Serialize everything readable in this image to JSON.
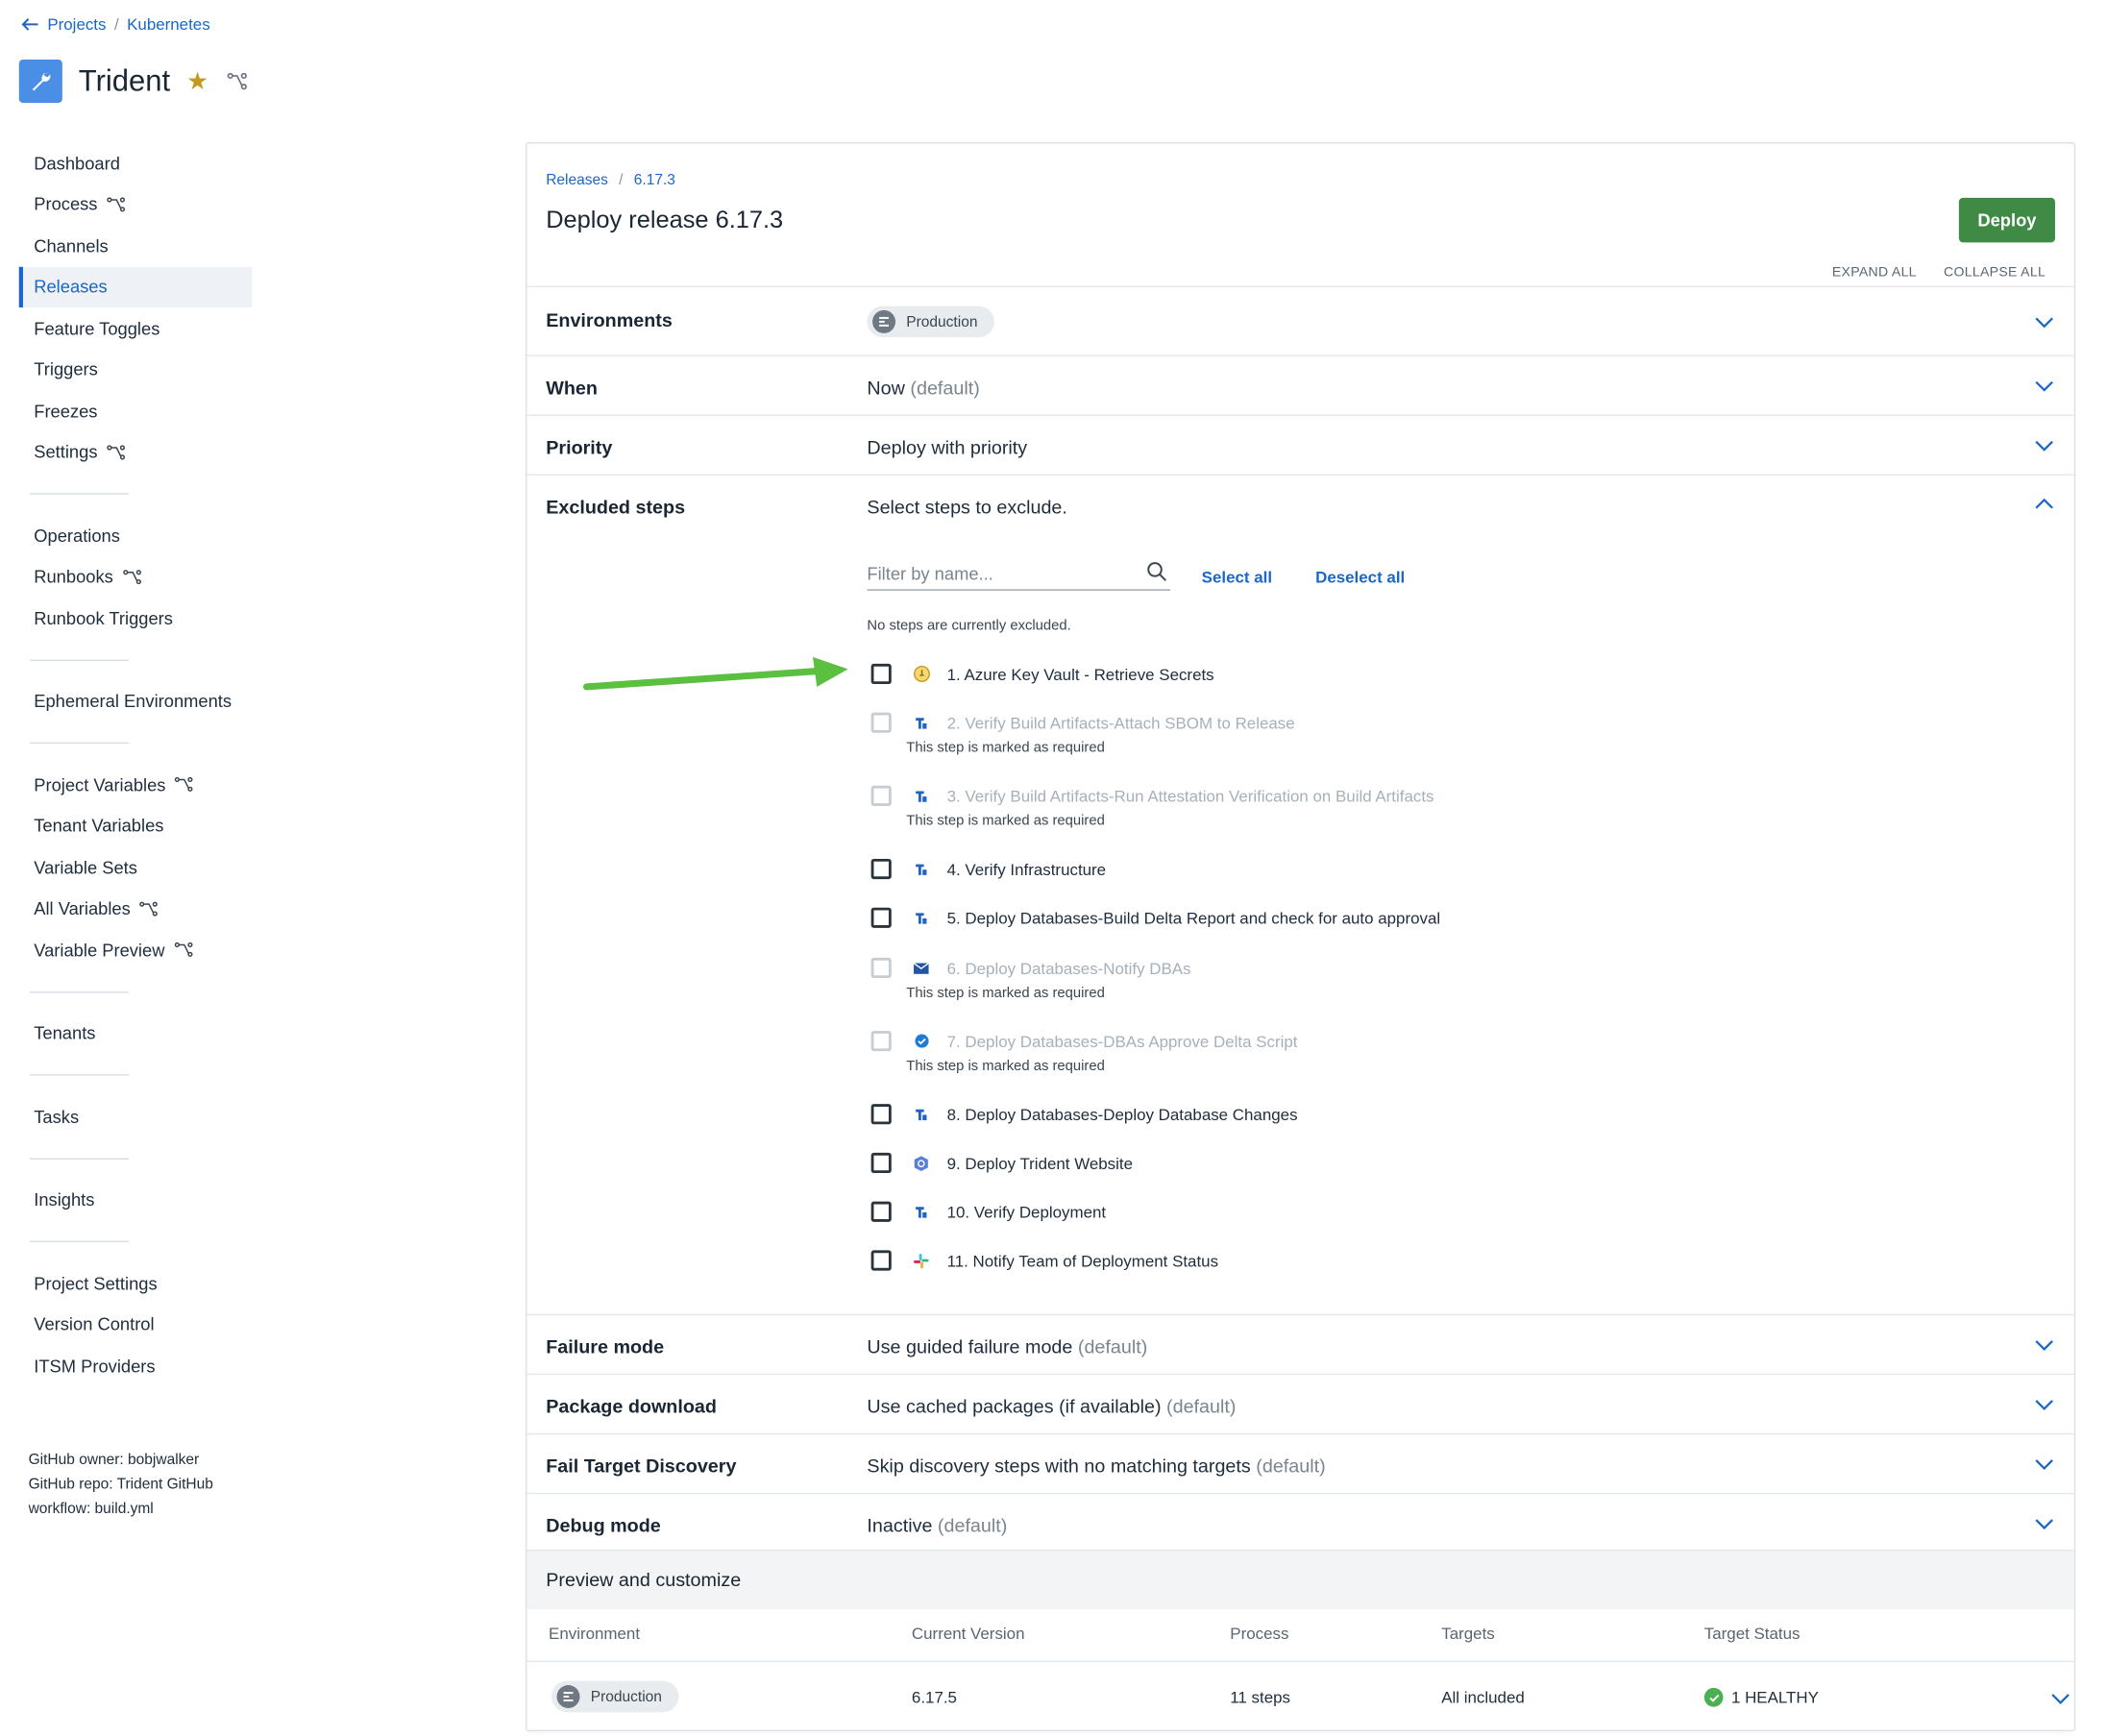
{
  "breadcrumb": {
    "projects": "Projects",
    "project_group": "Kubernetes"
  },
  "project": {
    "name": "Trident"
  },
  "sidebar": {
    "items": [
      {
        "label": "Dashboard",
        "git": false
      },
      {
        "label": "Process",
        "git": true
      },
      {
        "label": "Channels",
        "git": false
      },
      {
        "label": "Releases",
        "git": false,
        "active": true
      },
      {
        "label": "Feature Toggles",
        "git": false
      },
      {
        "label": "Triggers",
        "git": false
      },
      {
        "label": "Freezes",
        "git": false
      },
      {
        "label": "Settings",
        "git": true
      },
      {
        "label": "Operations",
        "git": false
      },
      {
        "label": "Runbooks",
        "git": true
      },
      {
        "label": "Runbook Triggers",
        "git": false
      },
      {
        "label": "Ephemeral Environments",
        "git": false
      },
      {
        "label": "Project Variables",
        "git": true
      },
      {
        "label": "Tenant Variables",
        "git": false
      },
      {
        "label": "Variable Sets",
        "git": false
      },
      {
        "label": "All Variables",
        "git": true
      },
      {
        "label": "Variable Preview",
        "git": true
      },
      {
        "label": "Tenants",
        "git": false
      },
      {
        "label": "Tasks",
        "git": false
      },
      {
        "label": "Insights",
        "git": false
      },
      {
        "label": "Project Settings",
        "git": false
      },
      {
        "label": "Version Control",
        "git": false
      },
      {
        "label": "ITSM Providers",
        "git": false
      }
    ],
    "github": {
      "owner": "GitHub owner: bobjwalker",
      "repo": "GitHub repo: Trident GitHub",
      "workflow": "workflow: build.yml"
    }
  },
  "main": {
    "breadcrumb": {
      "releases": "Releases",
      "version": "6.17.3"
    },
    "title": "Deploy release 6.17.3",
    "deploy_label": "Deploy",
    "expand_all": "EXPAND ALL",
    "collapse_all": "COLLAPSE ALL",
    "sections": {
      "environments": {
        "label": "Environments",
        "chip": "Production"
      },
      "when": {
        "label": "When",
        "value": "Now",
        "suffix": "(default)"
      },
      "priority": {
        "label": "Priority",
        "value": "Deploy with priority"
      },
      "excluded": {
        "label": "Excluded steps",
        "value": "Select steps to exclude."
      },
      "failure": {
        "label": "Failure mode",
        "value": "Use guided failure mode",
        "suffix": "(default)"
      },
      "package": {
        "label": "Package download",
        "value": "Use cached packages (if available)",
        "suffix": "(default)"
      },
      "fail_target": {
        "label": "Fail Target Discovery",
        "value": "Skip discovery steps with no matching targets",
        "suffix": "(default)"
      },
      "debug": {
        "label": "Debug mode",
        "value": "Inactive",
        "suffix": "(default)"
      }
    },
    "filter_placeholder": "Filter by name...",
    "select_all": "Select all",
    "deselect_all": "Deselect all",
    "no_excluded": "No steps are currently excluded.",
    "required_note": "This step is marked as required",
    "steps": [
      {
        "label": "1. Azure Key Vault - Retrieve Secrets",
        "required": false,
        "icon": "key-vault-icon"
      },
      {
        "label": "2. Verify Build Artifacts-Attach SBOM to Release",
        "required": true,
        "icon": "script-icon"
      },
      {
        "label": "3. Verify Build Artifacts-Run Attestation Verification on Build Artifacts",
        "required": true,
        "icon": "script-icon"
      },
      {
        "label": "4. Verify Infrastructure",
        "required": false,
        "icon": "script-icon"
      },
      {
        "label": "5. Deploy Databases-Build Delta Report and check for auto approval",
        "required": false,
        "icon": "script-icon"
      },
      {
        "label": "6. Deploy Databases-Notify DBAs",
        "required": true,
        "icon": "email-icon"
      },
      {
        "label": "7. Deploy Databases-DBAs Approve Delta Script",
        "required": true,
        "icon": "approval-icon"
      },
      {
        "label": "8. Deploy Databases-Deploy Database Changes",
        "required": false,
        "icon": "script-icon"
      },
      {
        "label": "9. Deploy Trident Website",
        "required": false,
        "icon": "kubernetes-icon"
      },
      {
        "label": "10. Verify Deployment",
        "required": false,
        "icon": "script-icon"
      },
      {
        "label": "11. Notify Team of Deployment Status",
        "required": false,
        "icon": "slack-icon"
      }
    ],
    "preview": {
      "title": "Preview and customize",
      "columns": [
        "Environment",
        "Current Version",
        "Process",
        "Targets",
        "Target Status"
      ],
      "row": {
        "environment": "Production",
        "current_version": "6.17.5",
        "process": "11 steps",
        "targets": "All included",
        "status": "1 HEALTHY"
      }
    }
  },
  "colors": {
    "accent": "#1a67c7",
    "deploy": "#3f8a45",
    "arrow": "#5bbf3f",
    "healthy": "#4caf50"
  }
}
